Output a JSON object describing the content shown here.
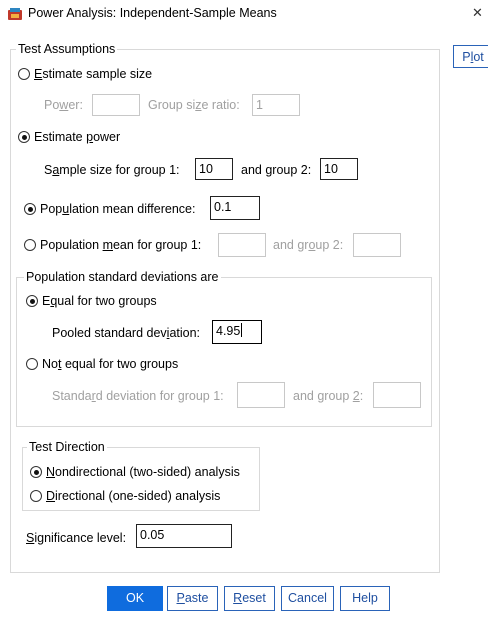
{
  "window": {
    "title": "Power Analysis: Independent-Sample Means",
    "close_glyph": "✕"
  },
  "test_assumptions": {
    "legend": "Test Assumptions",
    "estimate_sample_size": {
      "label_pre": "",
      "label_u": "E",
      "label_post": "stimate sample size",
      "checked": false
    },
    "power": {
      "label_pre": "Po",
      "label_u": "w",
      "label_post": "er:",
      "value": ""
    },
    "group_size_ratio": {
      "label_pre": "Group si",
      "label_u": "z",
      "label_post": "e ratio:",
      "value": "1"
    },
    "estimate_power": {
      "label_pre": "Estimate ",
      "label_u": "p",
      "label_post": "ower",
      "checked": true
    },
    "sample_size_group1": {
      "label_pre": "S",
      "label_u": "a",
      "label_post": "mple size for group 1:",
      "value": "10"
    },
    "sample_size_group2": {
      "label_pre": "and ",
      "label_u": "g",
      "label_post": "roup 2:",
      "value": "10"
    },
    "population_mean_difference": {
      "label_pre": "Pop",
      "label_u": "u",
      "label_post": "lation mean difference:",
      "checked": true,
      "value": "0.1"
    },
    "population_mean_group1": {
      "label_pre": "Population ",
      "label_u": "m",
      "label_post": "ean for group 1:",
      "checked": false,
      "value": ""
    },
    "population_mean_group2": {
      "label_pre": "and gr",
      "label_u": "o",
      "label_post": "up 2:",
      "value": ""
    },
    "std_devs": {
      "legend": "Population standard deviations are",
      "equal": {
        "label_pre": "E",
        "label_u": "q",
        "label_post": "ual for two groups",
        "checked": true
      },
      "pooled": {
        "label_pre": "Pooled standard dev",
        "label_u": "i",
        "label_post": "ation:",
        "value": "4.95"
      },
      "not_equal": {
        "label_pre": "No",
        "label_u": "t",
        "label_post": " equal for two groups",
        "checked": false
      },
      "sd_group1": {
        "label_pre": "Standa",
        "label_u": "r",
        "label_post": "d deviation for group 1:",
        "value": ""
      },
      "sd_group2": {
        "label_pre": "and group ",
        "label_u": "2",
        "label_post": ":",
        "value": ""
      }
    }
  },
  "test_direction": {
    "legend": "Test Direction",
    "nondirectional": {
      "label_pre": "",
      "label_u": "N",
      "label_post": "ondirectional (two-sided) analysis",
      "checked": true
    },
    "directional": {
      "label_pre": "",
      "label_u": "D",
      "label_post": "irectional (one-sided) analysis",
      "checked": false
    }
  },
  "significance": {
    "label_pre": "",
    "label_u": "S",
    "label_post": "ignificance level:",
    "value": "0.05"
  },
  "plot_button": {
    "label_pre": "P",
    "label_u": "l",
    "label_post": "ot"
  },
  "buttons": {
    "ok": "OK",
    "paste": {
      "u": "P",
      "rest": "aste"
    },
    "reset": {
      "u": "R",
      "rest": "eset"
    },
    "cancel": "Cancel",
    "help": "Help"
  },
  "colors": {
    "primary": "#0f6cde",
    "border": "#2a63b8",
    "disabled": "#a0a0a0"
  }
}
